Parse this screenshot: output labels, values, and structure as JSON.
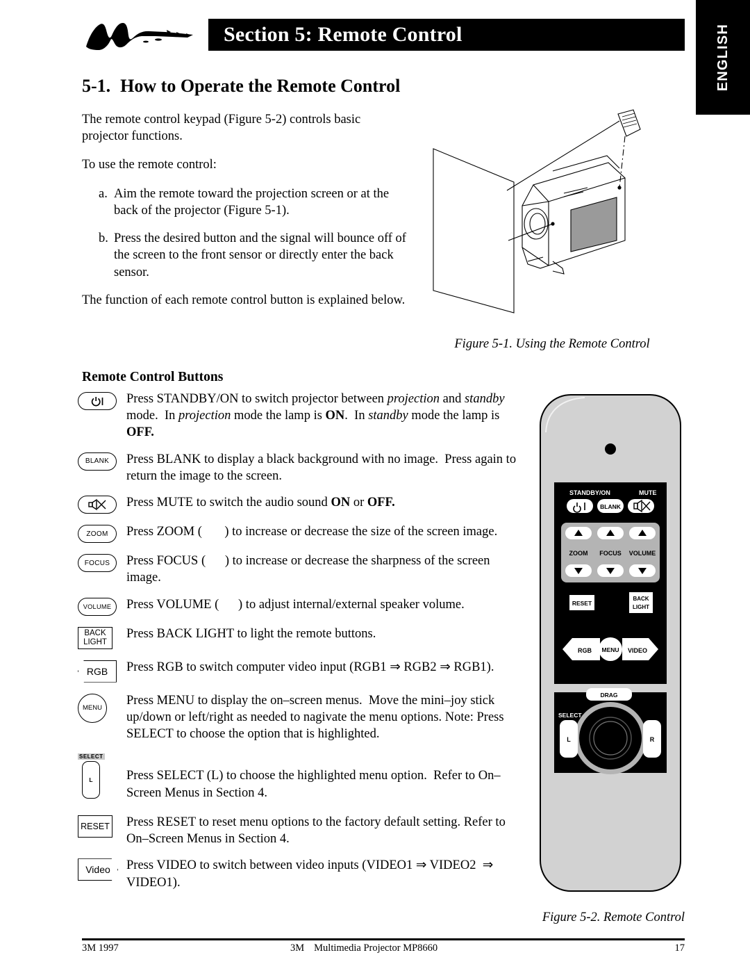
{
  "language_tab": "ENGLISH",
  "header": {
    "logo": "3m-brushstroke-logo",
    "title": "Section 5: Remote Control"
  },
  "section": {
    "number": "5-1.",
    "title": "How to Operate the Remote Control"
  },
  "intro": {
    "p1": "The remote control keypad (Figure 5-2) controls basic projector functions.",
    "p2": "To use the remote control:",
    "steps": [
      {
        "marker": "a.",
        "text": "Aim the remote toward the projection screen or at the back of the projector (Figure 5-1)."
      },
      {
        "marker": "b.",
        "text": "Press the desired button and the signal will bounce off of the screen to the front sensor or directly enter the back sensor."
      }
    ],
    "p3": "The function of each remote control button is explained below."
  },
  "figure1": {
    "caption": "Figure 5-1.  Using the Remote Control"
  },
  "figure2": {
    "caption": "Figure 5-2.  Remote Control"
  },
  "buttons_heading": "Remote Control Buttons",
  "buttons": [
    {
      "icon": "power-standby-on-icon",
      "icon_label": "",
      "desc_html": "Press STANDBY/ON to switch projector between <i>projection</i> and <i>standby</i> mode.&nbsp; In <i>projection</i> mode the lamp is <b>ON</b>.&nbsp; In <i>standby</i> mode the lamp is <b>OFF.</b>"
    },
    {
      "icon": "blank-button-icon",
      "icon_label": "BLANK",
      "desc_html": "Press BLANK to display a black background with no image.&nbsp; Press again to return the image to the screen."
    },
    {
      "icon": "mute-speaker-icon",
      "icon_label": "",
      "desc_html": "Press MUTE to switch the audio sound <b>ON</b> or <b>OFF.</b>"
    },
    {
      "icon": "zoom-button-icon",
      "icon_label": "ZOOM",
      "desc_html": "Press ZOOM (&nbsp;&nbsp;&nbsp;&nbsp;&nbsp;&nbsp;&nbsp;) to increase or decrease the size of the screen image."
    },
    {
      "icon": "focus-button-icon",
      "icon_label": "FOCUS",
      "desc_html": "Press FOCUS (&nbsp;&nbsp;&nbsp;&nbsp;&nbsp;&nbsp;) to increase or decrease the sharpness of the screen image."
    },
    {
      "icon": "volume-button-icon",
      "icon_label": "VOLUME",
      "desc_html": "Press VOLUME (&nbsp;&nbsp;&nbsp;&nbsp;&nbsp;&nbsp;) to adjust internal/external speaker volume."
    },
    {
      "icon": "back-light-button-icon",
      "icon_label": "BACK LIGHT",
      "desc_html": "Press BACK LIGHT to light the remote buttons."
    },
    {
      "icon": "rgb-button-icon",
      "icon_label": "RGB",
      "desc_html": "Press RGB to switch computer video input (RGB1 &rArr; RGB2 &rArr; RGB1)."
    },
    {
      "icon": "menu-button-icon",
      "icon_label": "MENU",
      "desc_html": "Press MENU to display the on&ndash;screen menus.&nbsp; Move the mini&ndash;joy stick up/down or left/right as needed to nagivate the menu options. Note: Press SELECT to choose the option that is highlighted."
    },
    {
      "icon": "select-left-button-icon",
      "icon_label": "L",
      "icon_sublabel": "SELECT",
      "desc_html": "Press SELECT (L) to choose the highlighted menu option.&nbsp; Refer to On&ndash;Screen Menus in Section 4."
    },
    {
      "icon": "reset-button-icon",
      "icon_label": "RESET",
      "desc_html": "Press RESET to reset menu options to the factory default setting. Refer to On&ndash;Screen Menus in Section 4."
    },
    {
      "icon": "video-button-icon",
      "icon_label": "Video",
      "desc_html": "Press VIDEO to switch between video inputs (VIDEO1 &rArr; VIDEO2 &nbsp;&rArr; VIDEO1)."
    }
  ],
  "remote_keypad": {
    "standby_label": "STANDBY/ON",
    "mute_label": "MUTE",
    "blank_label": "BLANK",
    "zoom_label": "ZOOM",
    "focus_label": "FOCUS",
    "volume_label": "VOLUME",
    "reset_label": "RESET",
    "backlight_label": "BACK LIGHT",
    "rgb_label": "RGB",
    "menu_label": "MENU",
    "video_label": "VIDEO",
    "drag_label": "DRAG",
    "select_label": "SELECT",
    "left_label": "L",
    "right_label": "R"
  },
  "footer": {
    "left": "3M 1997",
    "center_brand": "3M",
    "center_text": "Multimedia Projector MP8660",
    "page": "17"
  },
  "colors": {
    "ink": "#000000",
    "remote_body": "#d2d2d2",
    "remote_panel": "#000000",
    "keypad_group": "#b4b4b4"
  }
}
